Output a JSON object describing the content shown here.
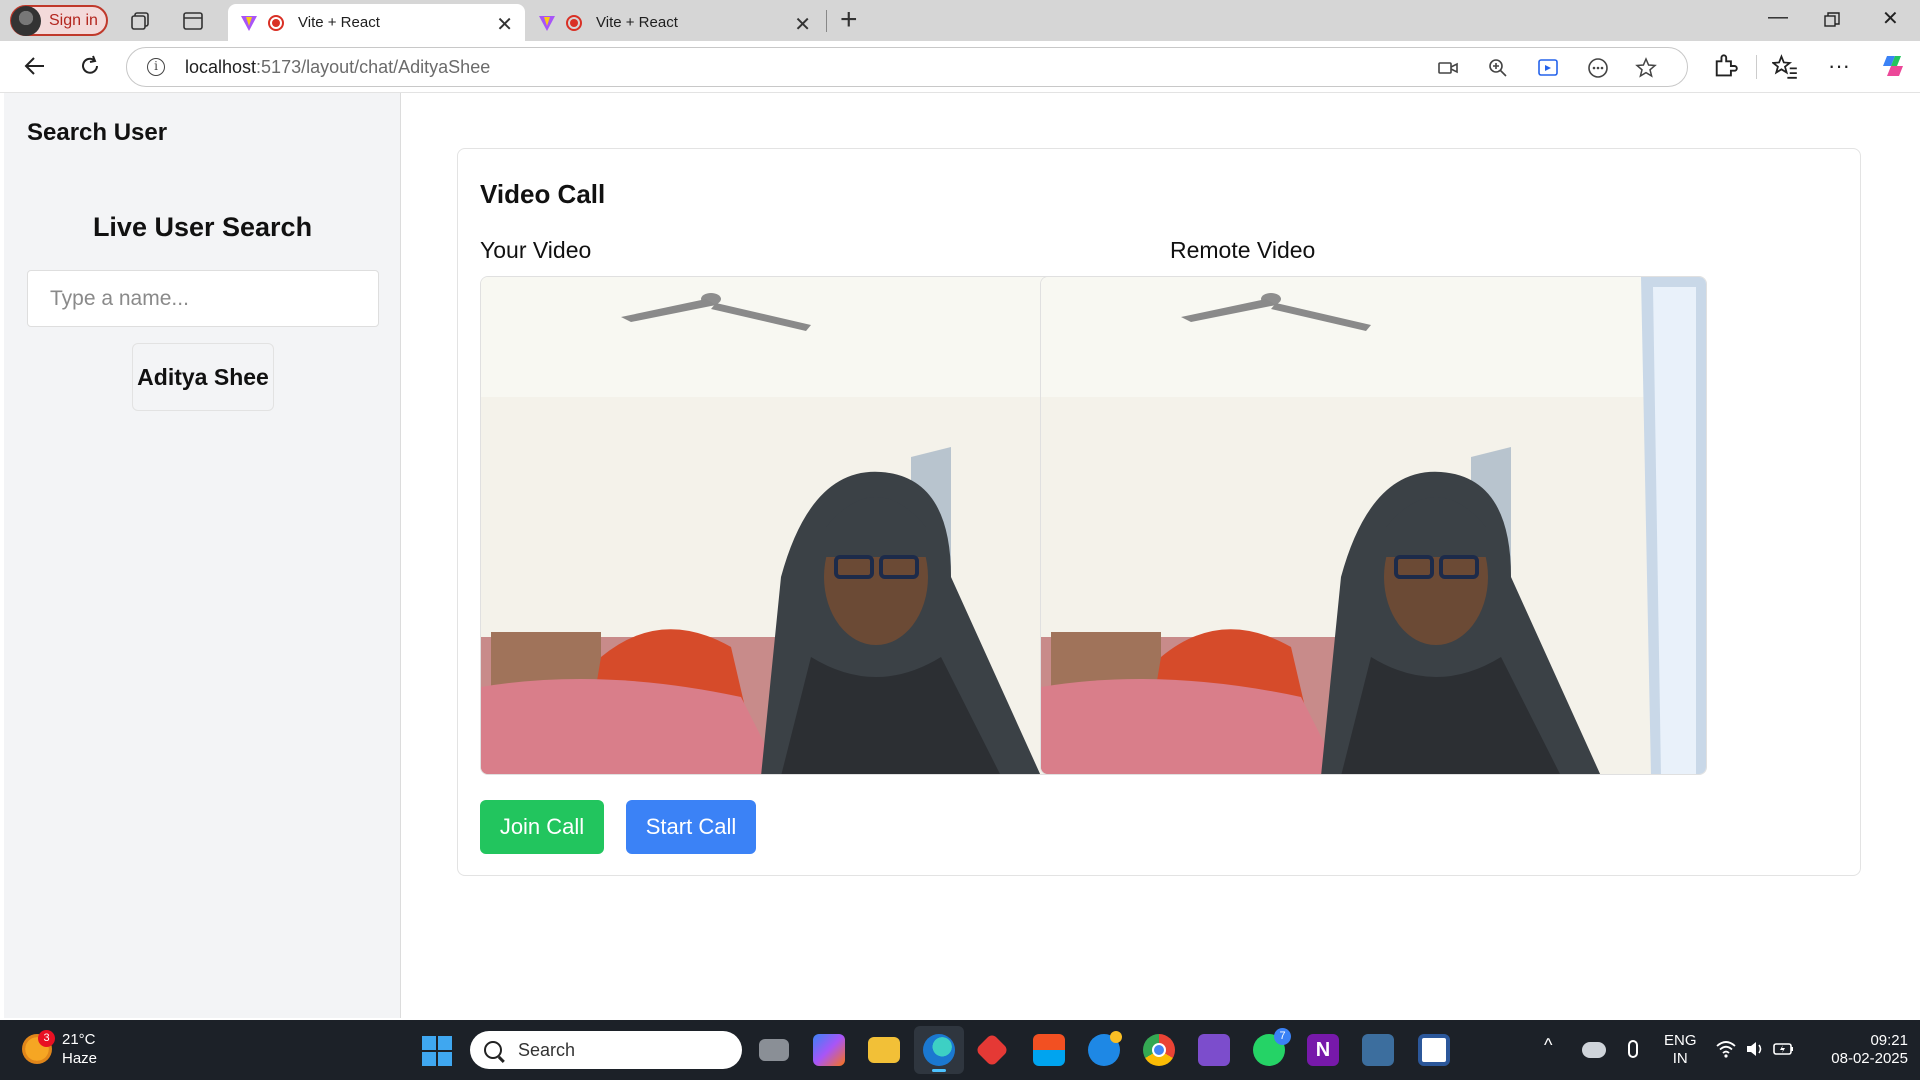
{
  "browser": {
    "signin_label": "Sign in",
    "tabs": [
      {
        "title": "Vite + React",
        "active": true
      },
      {
        "title": "Vite + React",
        "active": false
      }
    ],
    "url_host": "localhost",
    "url_path": ":5173/layout/chat/AdityaShee"
  },
  "sidebar": {
    "heading": "Search User",
    "subheading": "Live User Search",
    "search_placeholder": "Type a name...",
    "results": [
      "Aditya Shee"
    ]
  },
  "call": {
    "title": "Video Call",
    "local_label": "Your Video",
    "remote_label": "Remote Video",
    "join_label": "Join Call",
    "start_label": "Start Call",
    "colors": {
      "join": "#22c55e",
      "start": "#3b82f6"
    }
  },
  "taskbar": {
    "weather_temp": "21°C",
    "weather_desc": "Haze",
    "weather_badge": "3",
    "search_label": "Search",
    "whatsapp_badge": "7",
    "language_top": "ENG",
    "language_bottom": "IN",
    "time": "09:21",
    "date": "08-02-2025"
  }
}
